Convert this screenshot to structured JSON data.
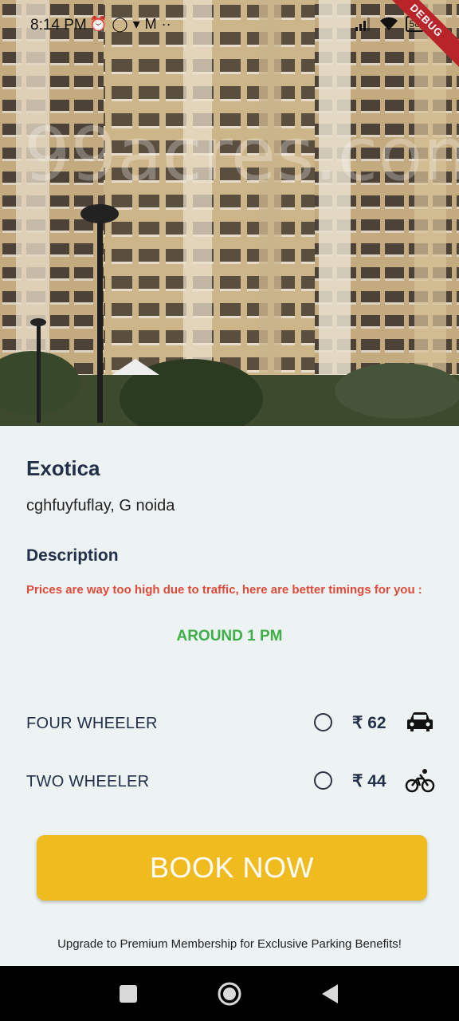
{
  "status_bar": {
    "time": "8:14 PM",
    "left_icons": [
      "alarm-icon",
      "whatsapp-icon",
      "signal-icon",
      "gmail-icon",
      "more-dots-icon"
    ],
    "right_icons": [
      "cell-signal-icon",
      "wifi-icon",
      "battery-icon"
    ],
    "battery": "58",
    "debug_banner": "DEBUG"
  },
  "hero": {
    "watermark": "99acres.com",
    "image": "apartment-building-photo"
  },
  "listing": {
    "title": "Exotica",
    "address": "cghfuyfuflay, G noida"
  },
  "description": {
    "heading": "Description",
    "text": "Prices are way too high due to traffic, here are better timings for you  :",
    "timing": "AROUND 1 PM"
  },
  "vehicles": [
    {
      "label": "FOUR WHEELER",
      "price": "₹ 62",
      "icon": "car-icon",
      "selected": false
    },
    {
      "label": "TWO WHEELER",
      "price": "₹ 44",
      "icon": "bicycle-icon",
      "selected": false
    }
  ],
  "book_button": "BOOK NOW",
  "premium_text": "Upgrade to Premium Membership for Exclusive Parking Benefits!",
  "nav": [
    "recents-icon",
    "home-icon",
    "back-icon"
  ],
  "colors": {
    "accent": "#efbb1e",
    "warning_text": "#e04a3a",
    "timing_text": "#3fae49",
    "heading": "#22304a",
    "background": "#edf3f3"
  }
}
